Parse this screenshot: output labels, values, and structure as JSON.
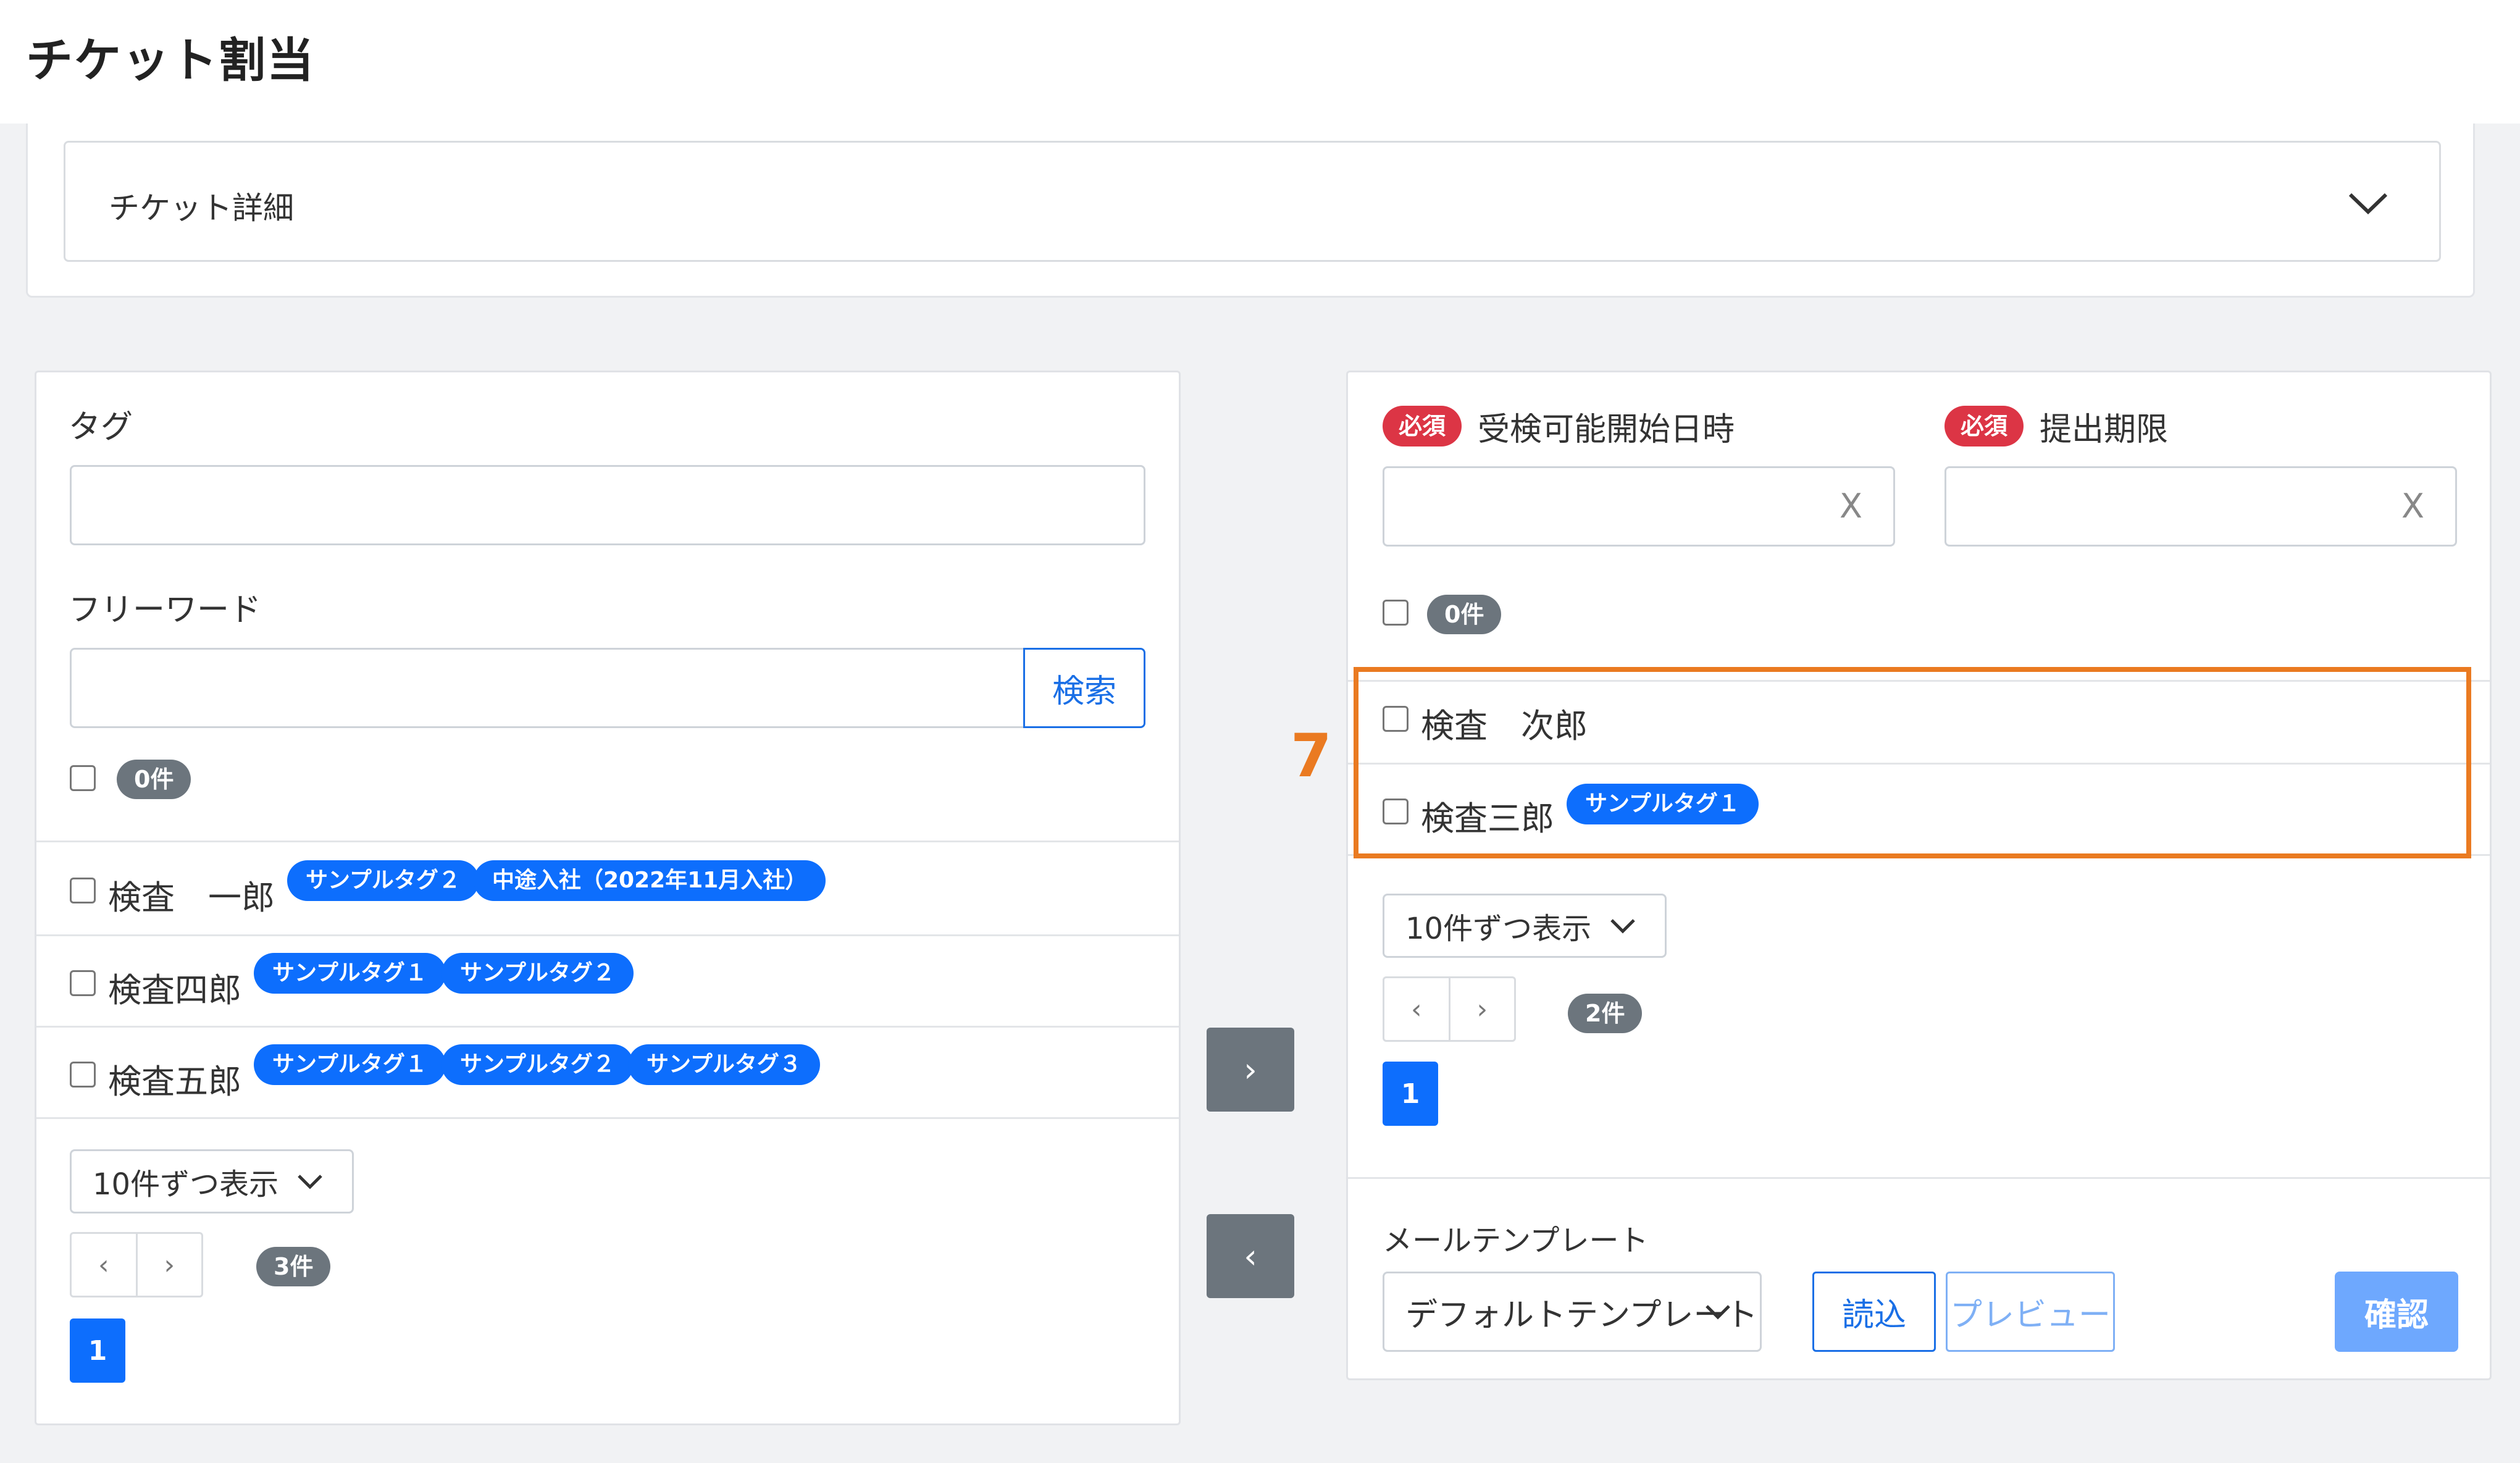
{
  "page": {
    "title": "チケット割当"
  },
  "detail": {
    "label": "チケット詳細"
  },
  "left": {
    "tag_label": "タグ",
    "tag_value": "",
    "freeword_label": "フリーワード",
    "freeword_value": "",
    "search_button": "検索",
    "selected_count": "0件",
    "rows": [
      {
        "name": "検査　一郎",
        "tags": [
          "サンプルタグ２",
          "中途入社（2022年11月入社）"
        ]
      },
      {
        "name": "検査四郎",
        "tags": [
          "サンプルタグ１",
          "サンプルタグ２"
        ]
      },
      {
        "name": "検査五郎",
        "tags": [
          "サンプルタグ１",
          "サンプルタグ２",
          "サンプルタグ３"
        ]
      }
    ],
    "page_size": "10件ずつ表示",
    "prev": "‹",
    "next": "›",
    "total": "3件",
    "current_page": "1"
  },
  "transfer": {
    "to_right": "›",
    "to_left": "‹"
  },
  "right": {
    "required_badge": "必須",
    "start_label": "受検可能開始日時",
    "deadline_label": "提出期限",
    "clear": "X",
    "selected_count": "0件",
    "rows": [
      {
        "name": "検査　次郎",
        "tags": []
      },
      {
        "name": "検査三郎",
        "tags": [
          "サンプルタグ１"
        ]
      }
    ],
    "page_size": "10件ずつ表示",
    "prev": "‹",
    "next": "›",
    "total": "2件",
    "current_page": "1",
    "mail_template_label": "メールテンプレート",
    "mail_template_value": "デフォルトテンプレート",
    "load_button": "読込",
    "preview_button": "プレビュー",
    "confirm_button": "確認"
  },
  "annotation": {
    "step": "7",
    "color": "#ea7a21"
  },
  "colors": {
    "primary": "#0d6efd",
    "danger": "#dc3545",
    "secondary": "#6c757d"
  }
}
